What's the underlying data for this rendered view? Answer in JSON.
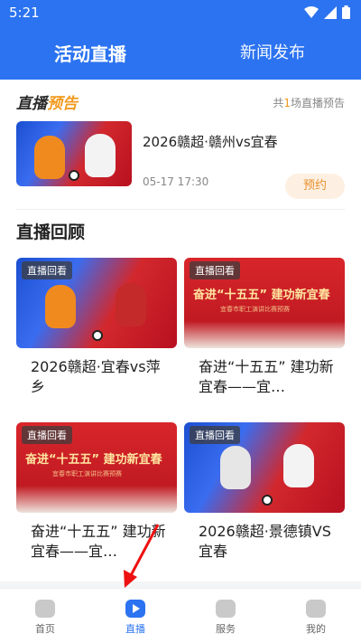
{
  "status_bar": {
    "time": "5:21"
  },
  "tabs": {
    "active": "活动直播",
    "inactive": "新闻发布"
  },
  "preview": {
    "logo_part1": "直播",
    "logo_part2": "预告",
    "count_prefix": "共",
    "count_num": "1",
    "count_suffix": "场直播预告",
    "item": {
      "title": "2026赣超·赣州vs宜春",
      "time": "05-17 17:30",
      "button": "预约"
    }
  },
  "review": {
    "title": "直播回顾",
    "badge": "直播回看",
    "items": [
      {
        "title": "2026赣超·宜春vs萍乡",
        "style": "game"
      },
      {
        "title": "奋进“十五五” 建功新宜春——宜…",
        "style": "red"
      },
      {
        "title": "奋进“十五五” 建功新宜春——宜…",
        "style": "red"
      },
      {
        "title": "2026赣超·景德镇VS宜春",
        "style": "game"
      }
    ],
    "red_banner": "奋进“十五五” 建功新宜春",
    "red_sub": "宜春市职工演讲比赛预赛"
  },
  "bottom_nav": [
    {
      "label": "首页",
      "icon": "home-icon"
    },
    {
      "label": "直播",
      "icon": "live-play-icon"
    },
    {
      "label": "服务",
      "icon": "service-icon"
    },
    {
      "label": "我的",
      "icon": "profile-icon"
    }
  ],
  "colors": {
    "accent": "#2b73f0",
    "orange": "#f29a1f"
  }
}
